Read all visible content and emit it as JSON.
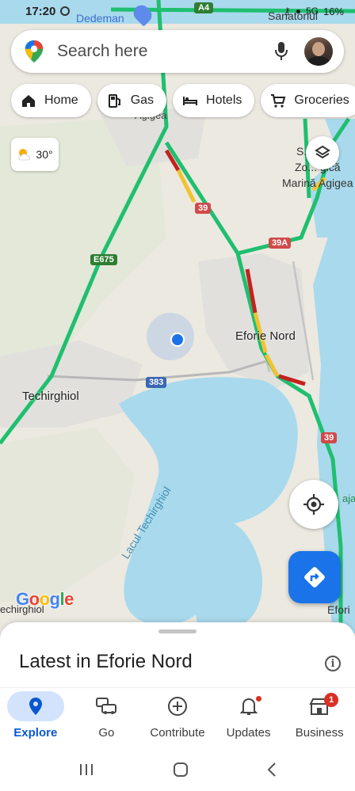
{
  "status_bar": {
    "time": "17:20",
    "battery": "16%",
    "signal": "5G"
  },
  "search": {
    "placeholder": "Search here"
  },
  "chips": [
    {
      "label": "Home",
      "icon": "home-icon"
    },
    {
      "label": "Gas",
      "icon": "gas-station-icon"
    },
    {
      "label": "Hotels",
      "icon": "bed-icon"
    },
    {
      "label": "Groceries",
      "icon": "cart-icon"
    }
  ],
  "weather": {
    "temp": "30°",
    "icon": "partly-cloudy-icon"
  },
  "map": {
    "labels": {
      "dedeman": "Dedeman",
      "sanatoriul": "Sanatoriul",
      "agigea": "Agigea",
      "zona_a": "S... ea",
      "zona_b": "Zo... gică",
      "marina": "Marină Agigea",
      "eforie_nord": "Eforie Nord",
      "techirghiol": "Techirghiol",
      "lacul": "Lacul Techirghiol",
      "techirghiol_edge": "echirghiol",
      "eforie_edge": "Efori",
      "baja": "aja",
      "road_a4": "A4",
      "road_39": "39",
      "road_39a": "39A",
      "road_e675": "E675",
      "road_383": "383",
      "road_39b": "39"
    }
  },
  "attribution": "Google",
  "sheet": {
    "title": "Latest in Eforie Nord"
  },
  "bottom_nav": [
    {
      "label": "Explore",
      "icon": "explore-pin-icon",
      "active": true
    },
    {
      "label": "Go",
      "icon": "car-icon"
    },
    {
      "label": "Contribute",
      "icon": "plus-circle-icon"
    },
    {
      "label": "Updates",
      "icon": "bell-icon"
    },
    {
      "label": "Business",
      "icon": "store-icon",
      "badge": "1"
    }
  ],
  "colors": {
    "accent": "#1a73e8",
    "water": "#a9d9ec",
    "land": "#ece9e1",
    "route_green": "#1fbf6f",
    "route_red": "#c5221f",
    "route_yellow": "#f2c230"
  }
}
